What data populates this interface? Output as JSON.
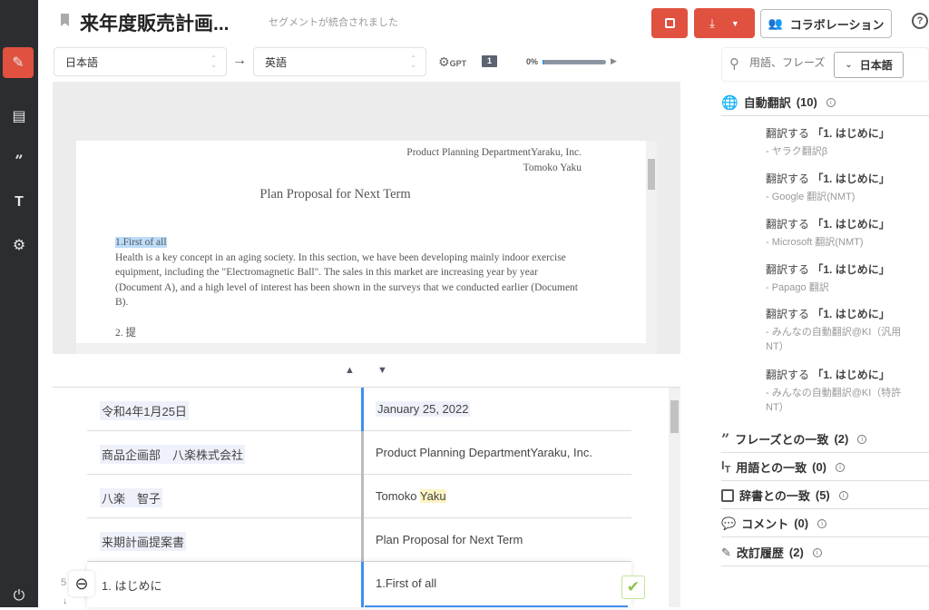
{
  "header": {
    "title": "来年度販売計画...",
    "status": "セグメントが統合されました",
    "collaboration_label": "コラボレーション",
    "help": "?"
  },
  "languages": {
    "source": "日本語",
    "target": "英語",
    "gpt_label": "GPT",
    "file_count": "1",
    "progress_label": "0%",
    "progress": 0
  },
  "preview": {
    "company": "Product Planning DepartmentYaraku, Inc.",
    "author": "Tomoko Yaku",
    "heading": "Plan Proposal for Next Term",
    "section": "1.First of all",
    "body": "Health is a key concept in an aging society. In this section, we have been developing mainly indoor exercise equipment, including the \"Electromagnetic Ball\". The sales in this market are increasing year by year (Document A), and a high level of interest has been shown in the surveys that we conducted earlier (Document B).",
    "next": "2. 提"
  },
  "segments": [
    {
      "source": "令和4年1月25日",
      "target": "January 25, 2022"
    },
    {
      "source": "商品企画部　八楽株式会社",
      "target": "Product Planning DepartmentYaraku, Inc."
    },
    {
      "source": "八楽　智子",
      "target_prefix": "Tomoko ",
      "target_highlight": "Yaku"
    },
    {
      "source": "来期計画提案書",
      "target": "Plan Proposal for Next Term"
    },
    {
      "number": "5",
      "source": "1. はじめに",
      "target": "1.First of all"
    }
  ],
  "search": {
    "placeholder": "用語、フレーズ",
    "language": "日本語"
  },
  "panel": {
    "auto_translation": "自動翻訳",
    "auto_count": "(10)",
    "mt_items": [
      {
        "action": "翻訳する",
        "term": "「1. はじめに」",
        "engine": "- ヤラク翻訳β"
      },
      {
        "action": "翻訳する",
        "term": "「1. はじめに」",
        "engine": "- Google 翻訳(NMT)"
      },
      {
        "action": "翻訳する",
        "term": "「1. はじめに」",
        "engine": "- Microsoft 翻訳(NMT)"
      },
      {
        "action": "翻訳する",
        "term": "「1. はじめに」",
        "engine": "- Papago 翻訳"
      },
      {
        "action": "翻訳する",
        "term": "「1. はじめに」",
        "engine": "- みんなの自動翻訳@KI（汎用NT）"
      },
      {
        "action": "翻訳する",
        "term": "「1. はじめに」",
        "engine": "- みんなの自動翻訳@KI（特許NT）"
      }
    ],
    "sections": [
      {
        "label": "フレーズとの一致",
        "count": "(2)"
      },
      {
        "label": "用語との一致",
        "count": "(0)"
      },
      {
        "label": "辞書との一致",
        "count": "(5)"
      },
      {
        "label": "コメント",
        "count": "(0)"
      },
      {
        "label": "改訂履歴",
        "count": "(2)"
      }
    ]
  },
  "colors": {
    "accent": "#e05140",
    "sidebar": "#2b2d30",
    "active_segment": "#3d8ef0",
    "confirm": "#8bc34a"
  }
}
